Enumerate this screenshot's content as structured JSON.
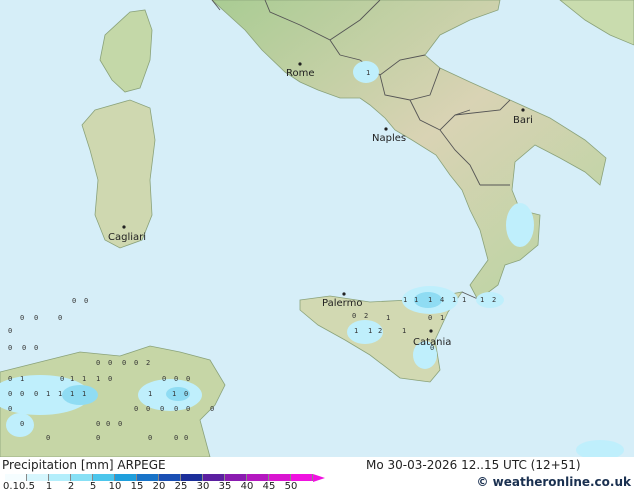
{
  "map": {
    "cities": [
      {
        "name": "Rome"
      },
      {
        "name": "Bari"
      },
      {
        "name": "Naples"
      },
      {
        "name": "Cagliari"
      },
      {
        "name": "Palermo"
      },
      {
        "name": "Catania"
      }
    ],
    "precip_values": [
      "0",
      "0",
      "0",
      "0",
      "0",
      "0",
      "0",
      "0",
      "0",
      "1",
      "1",
      "1",
      "1",
      "4",
      "1",
      "1",
      "1",
      "2",
      "1",
      "0",
      "1",
      "1",
      "1",
      "2",
      "1",
      "0",
      "0",
      "2",
      "0",
      "0",
      "0",
      "0",
      "2",
      "0",
      "1",
      "0",
      "1",
      "1",
      "1",
      "0",
      "0",
      "0",
      "0",
      "0",
      "0",
      "0",
      "1",
      "1",
      "1",
      "1",
      "1",
      "1",
      "0",
      "0",
      "0",
      "0",
      "0",
      "0",
      "0",
      "0",
      "0",
      "0",
      "0",
      "0",
      "0",
      "0",
      "0",
      "0",
      "0"
    ],
    "colors": {
      "sea": "#d6eef8",
      "land": "#e8e0c8",
      "land_green": "#b9d6a4",
      "border": "#555555",
      "precip_light": "#bfeffc",
      "precip_mid": "#8fdcf3"
    }
  },
  "footer": {
    "title": "Precipitation [mm]  ARPEGE",
    "datetime": "Mo 30-03-2026 12..15 UTC (12+51)",
    "copyright": "© weatheronline.co.uk",
    "legend_ticks": [
      "0.1",
      "0.5",
      "1",
      "2",
      "5",
      "10",
      "15",
      "20",
      "25",
      "30",
      "35",
      "40",
      "45",
      "50"
    ],
    "legend_colors": [
      "#f5fdff",
      "#d6f6fd",
      "#b4eefb",
      "#88e0f5",
      "#4cc6ec",
      "#1f9fdc",
      "#1873c8",
      "#1a4fb4",
      "#1c2f9a",
      "#5b1fa0",
      "#8a1bb0",
      "#b417c0",
      "#d915d0",
      "#f012e0"
    ]
  }
}
